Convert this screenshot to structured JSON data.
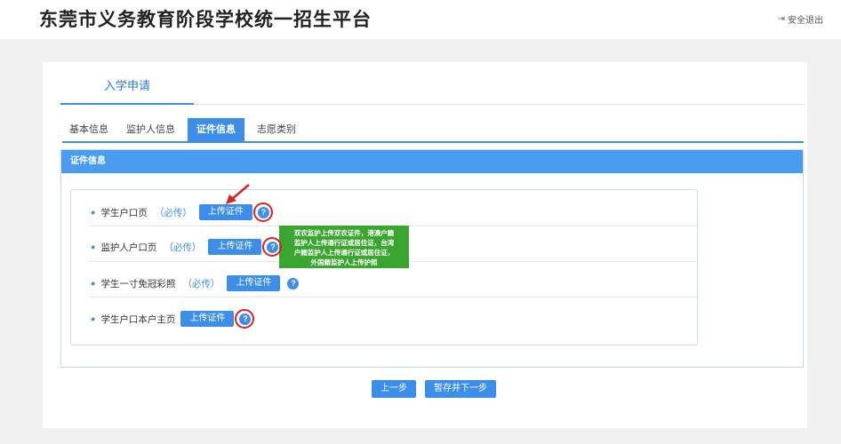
{
  "header": {
    "title": "东莞市义务教育阶段学校统一招生平台",
    "logout_label": "安全退出",
    "logout_icon": "logout-icon"
  },
  "apply_tab": "入学申请",
  "subtabs": [
    "基本信息",
    "监护人信息",
    "证件信息",
    "志愿类别"
  ],
  "active_subtab": "证件信息",
  "section_title": "证件信息",
  "documents": [
    {
      "label": "学生户口页",
      "required": "（必传）",
      "button": "上传证件",
      "circled": true
    },
    {
      "label": "监护人户口页",
      "required": "（必传）",
      "button": "上传证件",
      "circled": true
    },
    {
      "label": "学生一寸免冠彩照",
      "required": "（必传）",
      "button": "上传证件",
      "circled": false
    },
    {
      "label": "学生户口本户主页",
      "required": "",
      "button": "上传证件",
      "circled": true
    }
  ],
  "tooltip": {
    "lines": [
      "双农监护上传双农证件，港澳户籍",
      "监护人上传通行证或居住证，台湾",
      "户籍监护人上传通行证或居住证，",
      "外国籍监护人上传护照"
    ]
  },
  "footer": {
    "prev_label": "上一步",
    "save_next_label": "暂存并下一步"
  },
  "colors": {
    "accent": "#3d8ee8",
    "tooltip_bg": "#3aa630",
    "annotation": "#e02020"
  }
}
